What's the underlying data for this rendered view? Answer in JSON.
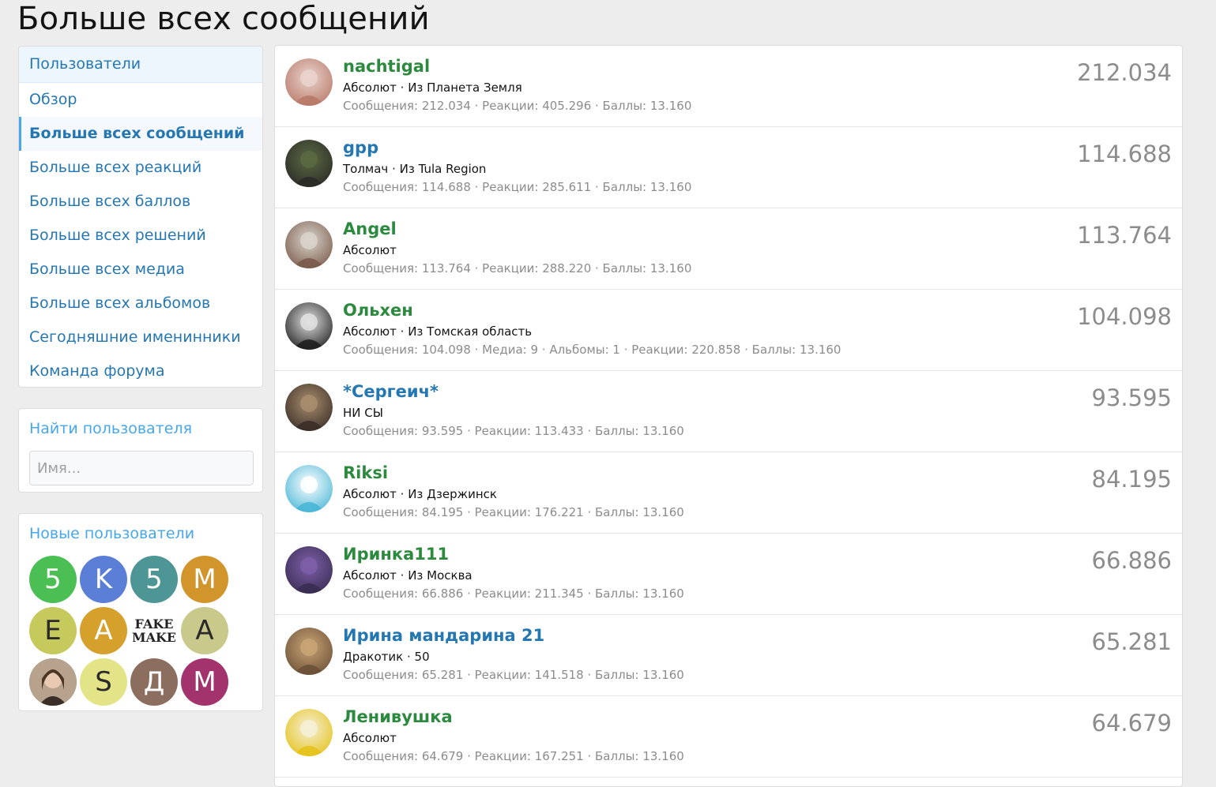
{
  "page": {
    "title": "Больше всех сообщений"
  },
  "colors": {
    "green_name": "#2c8a3e",
    "blue_name": "#2577b1",
    "link": "#2577b1",
    "muted": "#8c8c8c"
  },
  "nav": {
    "header": "Пользователи",
    "items": [
      {
        "label": "Обзор"
      },
      {
        "label": "Больше всех сообщений",
        "selected": true
      },
      {
        "label": "Больше всех реакций"
      },
      {
        "label": "Больше всех баллов"
      },
      {
        "label": "Больше всех решений"
      },
      {
        "label": "Больше всех медиа"
      },
      {
        "label": "Больше всех альбомов"
      },
      {
        "label": "Сегодняшние именинники"
      },
      {
        "label": "Команда форума"
      }
    ]
  },
  "find_user": {
    "title": "Найти пользователя",
    "placeholder": "Имя..."
  },
  "new_users": {
    "title": "Новые пользователи",
    "avatars": [
      {
        "letter": "5",
        "color": "#4bbf54"
      },
      {
        "letter": "K",
        "color": "#5b7fd6"
      },
      {
        "letter": "5",
        "color": "#4e9596"
      },
      {
        "letter": "M",
        "color": "#d2952c"
      },
      {
        "letter": "E",
        "color": "#c6c95c"
      },
      {
        "letter": "A",
        "color": "#d6a02c"
      },
      {
        "letter": "",
        "color": "#ffffff",
        "icon": "fake-make-avatar-icon"
      },
      {
        "letter": "A",
        "color": "#c9c98c"
      },
      {
        "letter": "",
        "color": "#7a6a5a",
        "icon": "photo-avatar-icon"
      },
      {
        "letter": "S",
        "color": "#e3e387"
      },
      {
        "letter": "Д",
        "color": "#8c6e5e"
      },
      {
        "letter": "M",
        "color": "#a3336c"
      }
    ]
  },
  "members": [
    {
      "name": "nachtigal",
      "name_color": "#2c8a3e",
      "title": "Абсолют · Из Планета Земля",
      "stats": "Сообщения: 212.034 · Реакции: 405.296 · Баллы: 13.160",
      "value": "212.034",
      "avatar_icon": "user-photo-icon",
      "avatar_colors": [
        "#e9d3cd",
        "#b87968"
      ]
    },
    {
      "name": "gpp",
      "name_color": "#2577b1",
      "title": "Толмач · Из Tula Region",
      "stats": "Сообщения: 114.688 · Реакции: 285.611 · Баллы: 13.160",
      "value": "114.688",
      "avatar_icon": "user-photo-icon",
      "avatar_colors": [
        "#5b6a42",
        "#2a2a28"
      ]
    },
    {
      "name": "Angel",
      "name_color": "#2c8a3e",
      "title": "Абсолют",
      "stats": "Сообщения: 113.764 · Реакции: 288.220 · Баллы: 13.160",
      "value": "113.764",
      "avatar_icon": "user-photo-icon",
      "avatar_colors": [
        "#d9d4cc",
        "#7a5a4a"
      ]
    },
    {
      "name": "Ольхен",
      "name_color": "#2c8a3e",
      "title": "Абсолют · Из Томская область",
      "stats": "Сообщения: 104.098 · Медиа: 9 · Альбомы: 1 · Реакции: 220.858 · Баллы: 13.160",
      "value": "104.098",
      "avatar_icon": "user-photo-icon",
      "avatar_colors": [
        "#e0e0e0",
        "#1e1e1e"
      ]
    },
    {
      "name": "*Сергеич*",
      "name_color": "#2577b1",
      "title": "НИ СЫ",
      "stats": "Сообщения: 93.595 · Реакции: 113.433 · Баллы: 13.160",
      "value": "93.595",
      "avatar_icon": "user-photo-icon",
      "avatar_colors": [
        "#a88d6d",
        "#3a2e28"
      ]
    },
    {
      "name": "Riksi",
      "name_color": "#2c8a3e",
      "title": "Абсолют · Из Дзержинск",
      "stats": "Сообщения: 84.195 · Реакции: 176.221 · Баллы: 13.160",
      "value": "84.195",
      "avatar_icon": "user-photo-icon",
      "avatar_colors": [
        "#ffffff",
        "#49b6d6"
      ]
    },
    {
      "name": "Иринка111",
      "name_color": "#2c8a3e",
      "title": "Абсолют · Из Москва",
      "stats": "Сообщения: 66.886 · Реакции: 211.345 · Баллы: 13.160",
      "value": "66.886",
      "avatar_icon": "user-photo-icon",
      "avatar_colors": [
        "#7d5fa8",
        "#3a2d52"
      ]
    },
    {
      "name": "Ирина мандарина 21",
      "name_color": "#2577b1",
      "title": "Дракотик · 50",
      "stats": "Сообщения: 65.281 · Реакции: 141.518 · Баллы: 13.160",
      "value": "65.281",
      "avatar_icon": "user-photo-icon",
      "avatar_colors": [
        "#c9a475",
        "#6b5038"
      ]
    },
    {
      "name": "Ленивушка",
      "name_color": "#2c8a3e",
      "title": "Абсолют",
      "stats": "Сообщения: 64.679 · Реакции: 167.251 · Баллы: 13.160",
      "value": "64.679",
      "avatar_icon": "user-photo-icon",
      "avatar_colors": [
        "#f5f0d8",
        "#e5c21a"
      ]
    }
  ]
}
